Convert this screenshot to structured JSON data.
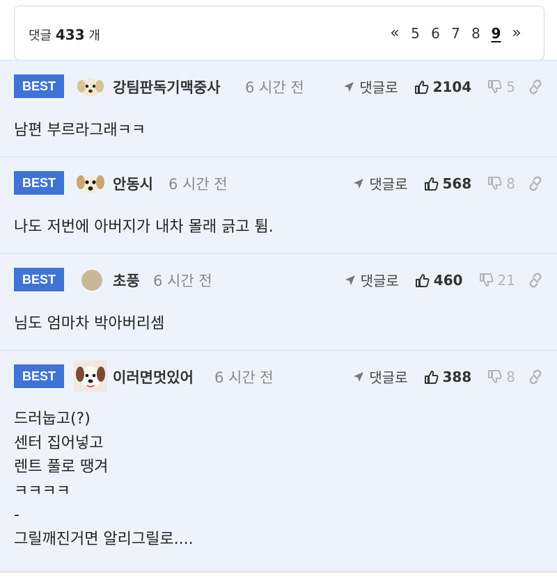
{
  "header": {
    "count_prefix": "댓글",
    "count_value": "433",
    "count_suffix": "개",
    "pager": {
      "prev": "«",
      "pages": [
        "5",
        "6",
        "7",
        "8",
        "9"
      ],
      "current": "9",
      "next": "»"
    }
  },
  "comments": [
    {
      "badge": "BEST",
      "nickname": "강팀판독기맥중사",
      "time": "6 시간 전",
      "reply_label": "댓글로",
      "likes": "2104",
      "dislikes": "5",
      "text": "남편 부르라그래ㅋㅋ"
    },
    {
      "badge": "BEST",
      "nickname": "안동시",
      "time": "6 시간 전",
      "reply_label": "댓글로",
      "likes": "568",
      "dislikes": "8",
      "text": "나도 저번에 아버지가 내차 몰래 긁고 튐."
    },
    {
      "badge": "BEST",
      "nickname": "초풍",
      "time": "6 시간 전",
      "reply_label": "댓글로",
      "likes": "460",
      "dislikes": "21",
      "text": "님도 엄마차 박아버리셈"
    },
    {
      "badge": "BEST",
      "nickname": "이러면멋있어",
      "time": "6 시간 전",
      "reply_label": "댓글로",
      "likes": "388",
      "dislikes": "8",
      "text": "드러눕고(?)\n센터 집어넣고\n렌트 풀로 땡겨\nㅋㅋㅋㅋ\n-\n그릴깨진거면 알리그릴로...."
    }
  ],
  "colors": {
    "best_badge": "#3f74d6",
    "comment_bg": "#eef3fb",
    "dislike": "#b0b6c0"
  },
  "icons": [
    "reply-arrow-icon",
    "thumbs-up-icon",
    "thumbs-down-icon",
    "link-icon",
    "dog-avatar-icon",
    "beige-circle-avatar-icon"
  ]
}
